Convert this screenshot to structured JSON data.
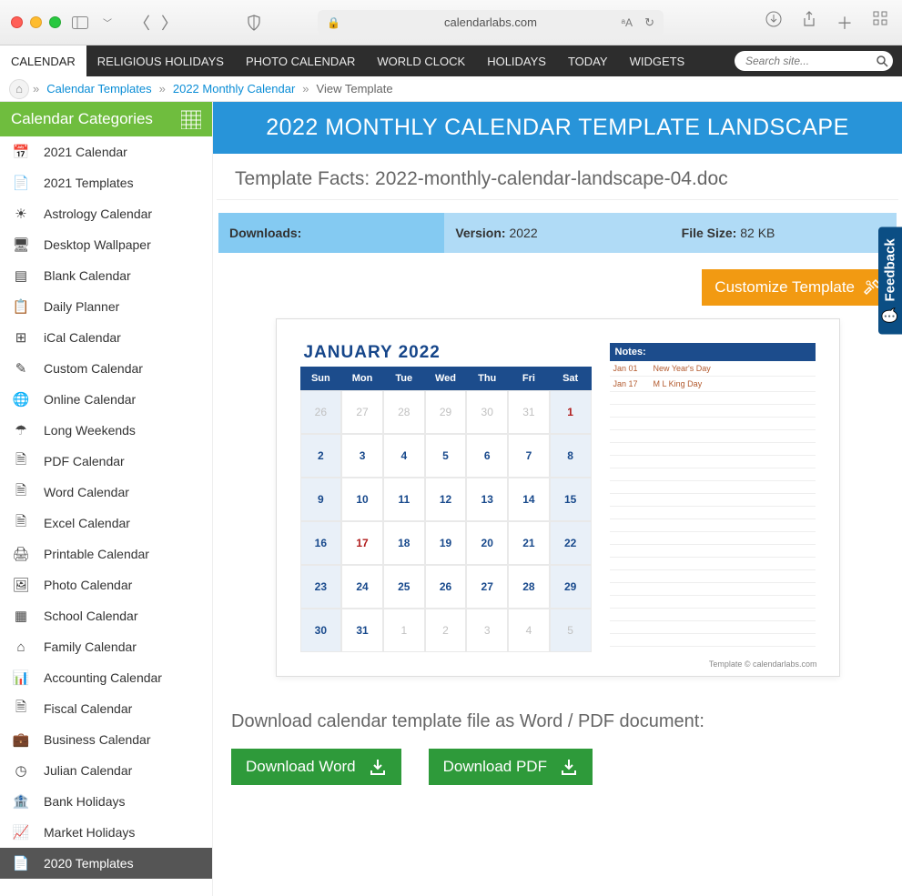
{
  "browser": {
    "url_display": "calendarlabs.com"
  },
  "nav": {
    "items": [
      "CALENDAR",
      "RELIGIOUS HOLIDAYS",
      "PHOTO CALENDAR",
      "WORLD CLOCK",
      "HOLIDAYS",
      "TODAY",
      "WIDGETS"
    ],
    "active_index": 0,
    "search_placeholder": "Search site..."
  },
  "breadcrumb": {
    "link1": "Calendar Templates",
    "link2": "2022 Monthly Calendar",
    "current": "View Template"
  },
  "sidebar": {
    "header": "Calendar Categories",
    "items": [
      {
        "icon": "📅",
        "label": "2021 Calendar"
      },
      {
        "icon": "📄",
        "label": "2021 Templates"
      },
      {
        "icon": "☀",
        "label": "Astrology Calendar"
      },
      {
        "icon": "🖥",
        "label": "Desktop Wallpaper"
      },
      {
        "icon": "▤",
        "label": "Blank Calendar"
      },
      {
        "icon": "📋",
        "label": "Daily Planner"
      },
      {
        "icon": "⊞",
        "label": "iCal Calendar"
      },
      {
        "icon": "✎",
        "label": "Custom Calendar"
      },
      {
        "icon": "🌐",
        "label": "Online Calendar"
      },
      {
        "icon": "☂",
        "label": "Long Weekends"
      },
      {
        "icon": "🗎",
        "label": "PDF Calendar"
      },
      {
        "icon": "🗎",
        "label": "Word Calendar"
      },
      {
        "icon": "🗎",
        "label": "Excel Calendar"
      },
      {
        "icon": "🖨",
        "label": "Printable Calendar"
      },
      {
        "icon": "🖼",
        "label": "Photo Calendar"
      },
      {
        "icon": "▦",
        "label": "School Calendar"
      },
      {
        "icon": "⌂",
        "label": "Family Calendar"
      },
      {
        "icon": "📊",
        "label": "Accounting Calendar"
      },
      {
        "icon": "🗎",
        "label": "Fiscal Calendar"
      },
      {
        "icon": "💼",
        "label": "Business Calendar"
      },
      {
        "icon": "◷",
        "label": "Julian Calendar"
      },
      {
        "icon": "🏦",
        "label": "Bank Holidays"
      },
      {
        "icon": "📈",
        "label": "Market Holidays"
      },
      {
        "icon": "📄",
        "label": "2020 Templates"
      }
    ],
    "active_index": 23
  },
  "page": {
    "title": "2022 MONTHLY CALENDAR TEMPLATE LANDSCAPE",
    "facts_title": "Template Facts: 2022-monthly-calendar-landscape-04.doc",
    "facts": {
      "downloads_label": "Downloads:",
      "downloads_value": "",
      "version_label": "Version:",
      "version_value": "2022",
      "filesize_label": "File Size:",
      "filesize_value": "82 KB"
    },
    "customize_label": "Customize Template",
    "download_title": "Download calendar template file as Word / PDF document:",
    "download_word": "Download Word",
    "download_pdf": "Download PDF",
    "feedback": "Feedback"
  },
  "preview": {
    "month_title": "JANUARY 2022",
    "dow": [
      "Sun",
      "Mon",
      "Tue",
      "Wed",
      "Thu",
      "Fri",
      "Sat"
    ],
    "grid": [
      [
        {
          "n": "26",
          "o": true
        },
        {
          "n": "27",
          "o": true
        },
        {
          "n": "28",
          "o": true
        },
        {
          "n": "29",
          "o": true
        },
        {
          "n": "30",
          "o": true
        },
        {
          "n": "31",
          "o": true
        },
        {
          "n": "1",
          "h": true
        }
      ],
      [
        {
          "n": "2"
        },
        {
          "n": "3"
        },
        {
          "n": "4"
        },
        {
          "n": "5"
        },
        {
          "n": "6"
        },
        {
          "n": "7"
        },
        {
          "n": "8"
        }
      ],
      [
        {
          "n": "9"
        },
        {
          "n": "10"
        },
        {
          "n": "11"
        },
        {
          "n": "12"
        },
        {
          "n": "13"
        },
        {
          "n": "14"
        },
        {
          "n": "15"
        }
      ],
      [
        {
          "n": "16"
        },
        {
          "n": "17",
          "h": true
        },
        {
          "n": "18"
        },
        {
          "n": "19"
        },
        {
          "n": "20"
        },
        {
          "n": "21"
        },
        {
          "n": "22"
        }
      ],
      [
        {
          "n": "23"
        },
        {
          "n": "24"
        },
        {
          "n": "25"
        },
        {
          "n": "26"
        },
        {
          "n": "27"
        },
        {
          "n": "28"
        },
        {
          "n": "29"
        }
      ],
      [
        {
          "n": "30"
        },
        {
          "n": "31"
        },
        {
          "n": "1",
          "o": true
        },
        {
          "n": "2",
          "o": true
        },
        {
          "n": "3",
          "o": true
        },
        {
          "n": "4",
          "o": true
        },
        {
          "n": "5",
          "o": true
        }
      ]
    ],
    "notes_header": "Notes:",
    "notes": [
      {
        "date": "Jan 01",
        "text": "New Year's Day"
      },
      {
        "date": "Jan 17",
        "text": "M L King Day"
      }
    ],
    "attribution": "Template © calendarlabs.com"
  }
}
